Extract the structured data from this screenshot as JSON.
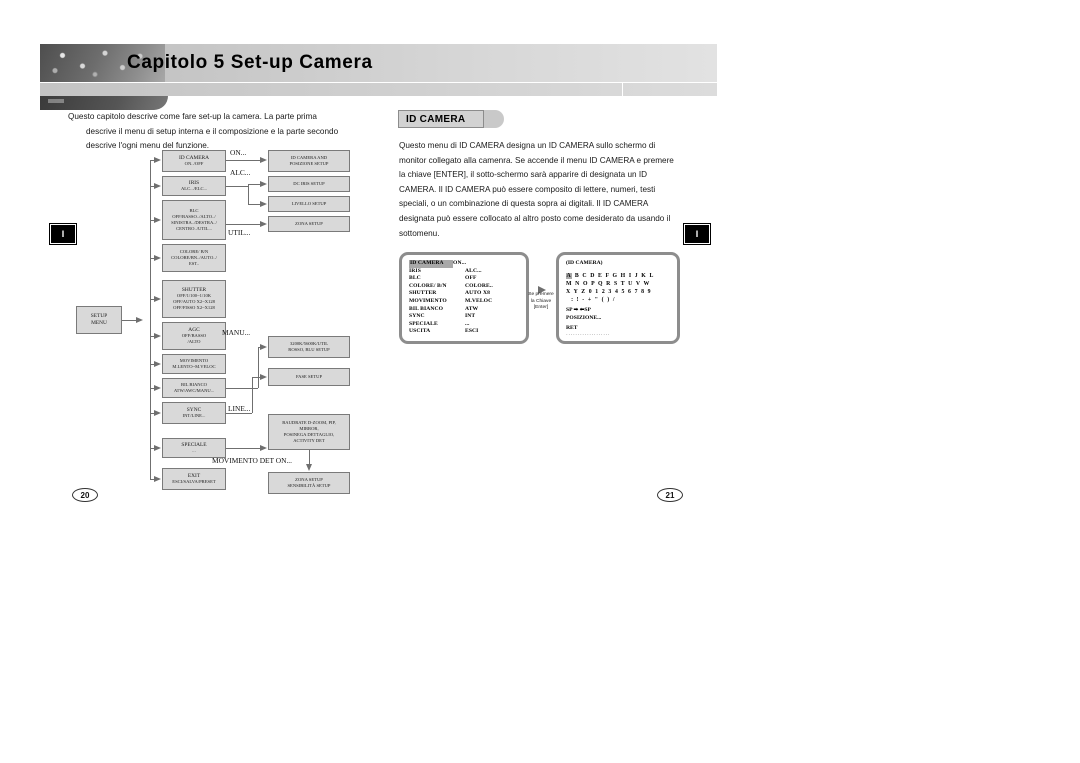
{
  "header": {
    "chapter_title": "Capitolo 5 Set-up Camera"
  },
  "left_page": {
    "intro": {
      "line1": "Questo capitolo descrive come fare set-up la camera. La parte prima",
      "line2": "descrive il menu di setup interna e il composizione e la parte secondo",
      "line3": "descrive l'ogni menu del funzione."
    },
    "marker": "I",
    "page_number": "20",
    "diagram": {
      "root": {
        "line1": "SETUP",
        "line2": "MENU"
      },
      "menu_items": [
        {
          "title": "ID CAMERA",
          "lines": [
            "ON../OFF"
          ]
        },
        {
          "title": "IRIS",
          "lines": [
            "ALC.../ELC..."
          ]
        },
        {
          "title": "BLC",
          "lines": [
            "OFF/BASSO../ALTO../",
            "SINISTRA../DESTRA../",
            "CENTRO../UTIL..."
          ]
        },
        {
          "title": "COLORE/ B/N",
          "lines": [
            "COLORE/BN../AUTO../",
            "EST.."
          ]
        },
        {
          "title": "SHUTTER",
          "lines": [
            "OFF/1/100~1/10K",
            "OFF/AUTO X2~X128",
            "OFF/FISSO X2~X128"
          ]
        },
        {
          "title": "AGC",
          "lines": [
            "OFF/BASSO",
            "/ALTO"
          ]
        },
        {
          "title": "MOVIMENTO",
          "lines": [
            "M.LENTO~M.VELOC"
          ]
        },
        {
          "title": "BIL BIANCO",
          "lines": [
            "ATW/AWC/MANU..."
          ]
        },
        {
          "title": "SYNC",
          "lines": [
            "INT/LINE..."
          ]
        },
        {
          "title": "SPECIALE",
          "lines": [
            "..."
          ]
        },
        {
          "title": "EXIT",
          "lines": [
            "ESCI/SALVA/PRESET"
          ]
        }
      ],
      "sub_boxes": [
        {
          "id": "id-camera-pos",
          "lines": [
            "ID CAMERA AND",
            "POSIZIONE SETUP"
          ]
        },
        {
          "id": "dc-iris",
          "lines": [
            "DC IRIS SETUP"
          ]
        },
        {
          "id": "livello",
          "lines": [
            "LIVELLO SETUP"
          ]
        },
        {
          "id": "zona",
          "lines": [
            "ZONA SETUP"
          ]
        },
        {
          "id": "manu-wb",
          "lines": [
            "3200K/5600K/UTIL",
            "ROSSO, BLU SETUP"
          ]
        },
        {
          "id": "fase",
          "lines": [
            "FASE SETUP"
          ]
        },
        {
          "id": "speciale-sub",
          "lines": [
            "BAUDRATE D-ZOOM, PIP,",
            "MIRROR,",
            "POSINEGA DETTAGLIO,",
            "ACTIVITY DET"
          ]
        },
        {
          "id": "zona-sens",
          "lines": [
            "ZONA SETUP",
            "SENSIBILITÀ SETUP"
          ]
        }
      ],
      "edge_labels": [
        {
          "id": "on",
          "text": "ON..."
        },
        {
          "id": "alc",
          "text": "ALC..."
        },
        {
          "id": "util",
          "text": "UTIL..."
        },
        {
          "id": "manu",
          "text": "MANU..."
        },
        {
          "id": "line",
          "text": "LINE..."
        },
        {
          "id": "movimento-det",
          "text": "MOVIMENTO DET ON..."
        }
      ]
    }
  },
  "right_page": {
    "section_title": "ID CAMERA",
    "marker": "I",
    "page_number": "21",
    "body": {
      "line1": "Questo menu di ID CAMERA designa un ID CAMERA sullo schermo di",
      "line2": "monitor collegato alla camenra. Se accende il menu ID CAMERA e premere",
      "line3": "la chiave [ENTER], il sotto-schermo sarà apparire di designata un ID",
      "line4": "CAMERA. Il ID CAMERA può essere composito di lettere, numeri, testi",
      "line5": "speciali, o un combinazione di questa sopra ai digitali. Il ID CAMERA",
      "line6": "designata può essere collocato al altro posto come desiderato da usando il",
      "line7": "sottomenu."
    },
    "osd_menu": {
      "rows": [
        {
          "key": "ID CAMERA",
          "value": "ON...",
          "selected": true
        },
        {
          "key": "IRIS",
          "value": "ALC...",
          "selected": false
        },
        {
          "key": "BLC",
          "value": "OFF",
          "selected": false
        },
        {
          "key": "COLORE/ B/N",
          "value": "COLORE..",
          "selected": false
        },
        {
          "key": "SHUTTER",
          "value": "AUTO X8",
          "selected": false
        },
        {
          "key": "MOVIMENTO",
          "value": "M.VELOC",
          "selected": false
        },
        {
          "key": "BIL BIANCO",
          "value": "ATW",
          "selected": false
        },
        {
          "key": "SYNC",
          "value": "INT",
          "selected": false
        },
        {
          "key": "SPECIALE",
          "value": "...",
          "selected": false
        },
        {
          "key": "USCITA",
          "value": "ESCI",
          "selected": false
        }
      ]
    },
    "osd_link": {
      "caption_line1": "Se premere",
      "caption_line2": "la Chiave",
      "caption_line3": "[Enter]"
    },
    "osd_id": {
      "title": "(ID CAMERA)",
      "selected_char": "A",
      "char_rows": [
        " B C D E F G H I J K L",
        "M N O P Q R S T U V W",
        "X Y Z 0 1 2 3 4 5 6 7 8 9",
        "  : ! - + \" ( ) /"
      ],
      "footer": [
        "SP ➡ ⬅SP",
        "POSIZIONE...",
        "RET"
      ],
      "dots": "···················"
    }
  }
}
